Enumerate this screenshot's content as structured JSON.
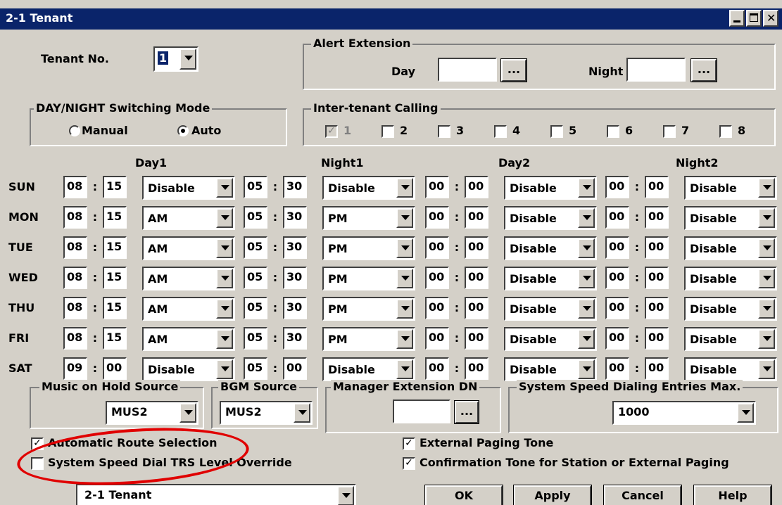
{
  "window": {
    "title": "2-1 Tenant"
  },
  "tenant": {
    "label": "Tenant No.",
    "value": "1"
  },
  "alert_extension": {
    "legend": "Alert Extension",
    "day_label": "Day",
    "day_value": "",
    "night_label": "Night",
    "night_value": "",
    "browse_label": "..."
  },
  "mode": {
    "legend": "DAY/NIGHT Switching Mode",
    "manual_label": "Manual",
    "auto_label": "Auto",
    "selected": "Auto"
  },
  "inter_tenant": {
    "legend": "Inter-tenant Calling",
    "items": [
      {
        "label": "1",
        "checked": true,
        "disabled": true
      },
      {
        "label": "2",
        "checked": false
      },
      {
        "label": "3",
        "checked": false
      },
      {
        "label": "4",
        "checked": false
      },
      {
        "label": "5",
        "checked": false
      },
      {
        "label": "6",
        "checked": false
      },
      {
        "label": "7",
        "checked": false
      },
      {
        "label": "8",
        "checked": false
      }
    ]
  },
  "schedule": {
    "headers": [
      "Day1",
      "Night1",
      "Day2",
      "Night2"
    ],
    "colon": ":",
    "rows": [
      {
        "day": "SUN",
        "d1": [
          "08",
          "15",
          "Disable"
        ],
        "n1": [
          "05",
          "30",
          "Disable"
        ],
        "d2": [
          "00",
          "00",
          "Disable"
        ],
        "n2": [
          "00",
          "00",
          "Disable"
        ]
      },
      {
        "day": "MON",
        "d1": [
          "08",
          "15",
          "AM"
        ],
        "n1": [
          "05",
          "30",
          "PM"
        ],
        "d2": [
          "00",
          "00",
          "Disable"
        ],
        "n2": [
          "00",
          "00",
          "Disable"
        ]
      },
      {
        "day": "TUE",
        "d1": [
          "08",
          "15",
          "AM"
        ],
        "n1": [
          "05",
          "30",
          "PM"
        ],
        "d2": [
          "00",
          "00",
          "Disable"
        ],
        "n2": [
          "00",
          "00",
          "Disable"
        ]
      },
      {
        "day": "WED",
        "d1": [
          "08",
          "15",
          "AM"
        ],
        "n1": [
          "05",
          "30",
          "PM"
        ],
        "d2": [
          "00",
          "00",
          "Disable"
        ],
        "n2": [
          "00",
          "00",
          "Disable"
        ]
      },
      {
        "day": "THU",
        "d1": [
          "08",
          "15",
          "AM"
        ],
        "n1": [
          "05",
          "30",
          "PM"
        ],
        "d2": [
          "00",
          "00",
          "Disable"
        ],
        "n2": [
          "00",
          "00",
          "Disable"
        ]
      },
      {
        "day": "FRI",
        "d1": [
          "08",
          "15",
          "AM"
        ],
        "n1": [
          "05",
          "30",
          "PM"
        ],
        "d2": [
          "00",
          "00",
          "Disable"
        ],
        "n2": [
          "00",
          "00",
          "Disable"
        ]
      },
      {
        "day": "SAT",
        "d1": [
          "09",
          "00",
          "Disable"
        ],
        "n1": [
          "05",
          "00",
          "Disable"
        ],
        "d2": [
          "00",
          "00",
          "Disable"
        ],
        "n2": [
          "00",
          "00",
          "Disable"
        ]
      }
    ]
  },
  "music_on_hold": {
    "legend": "Music on Hold Source",
    "value": "MUS2"
  },
  "bgm": {
    "legend": "BGM Source",
    "value": "MUS2"
  },
  "manager_ext": {
    "legend": "Manager Extension DN",
    "value": "",
    "browse_label": "..."
  },
  "speed_dial_max": {
    "legend": "System Speed Dialing Entries Max.",
    "value": "1000"
  },
  "options": {
    "ars": {
      "label": "Automatic Route Selection",
      "checked": true
    },
    "trs": {
      "label": "System Speed Dial TRS Level Override",
      "checked": false
    },
    "ext_paging": {
      "label": "External Paging Tone",
      "checked": true
    },
    "confirm_tone": {
      "label": "Confirmation Tone for Station or External Paging",
      "checked": true
    }
  },
  "bottom": {
    "selector_value": "2-1 Tenant",
    "ok": "OK",
    "apply": "Apply",
    "cancel": "Cancel",
    "help": "Help"
  },
  "colors": {
    "title_bar": "#0a246a",
    "dialog": "#d4d0c8",
    "highlight_oval": "#e00000"
  }
}
